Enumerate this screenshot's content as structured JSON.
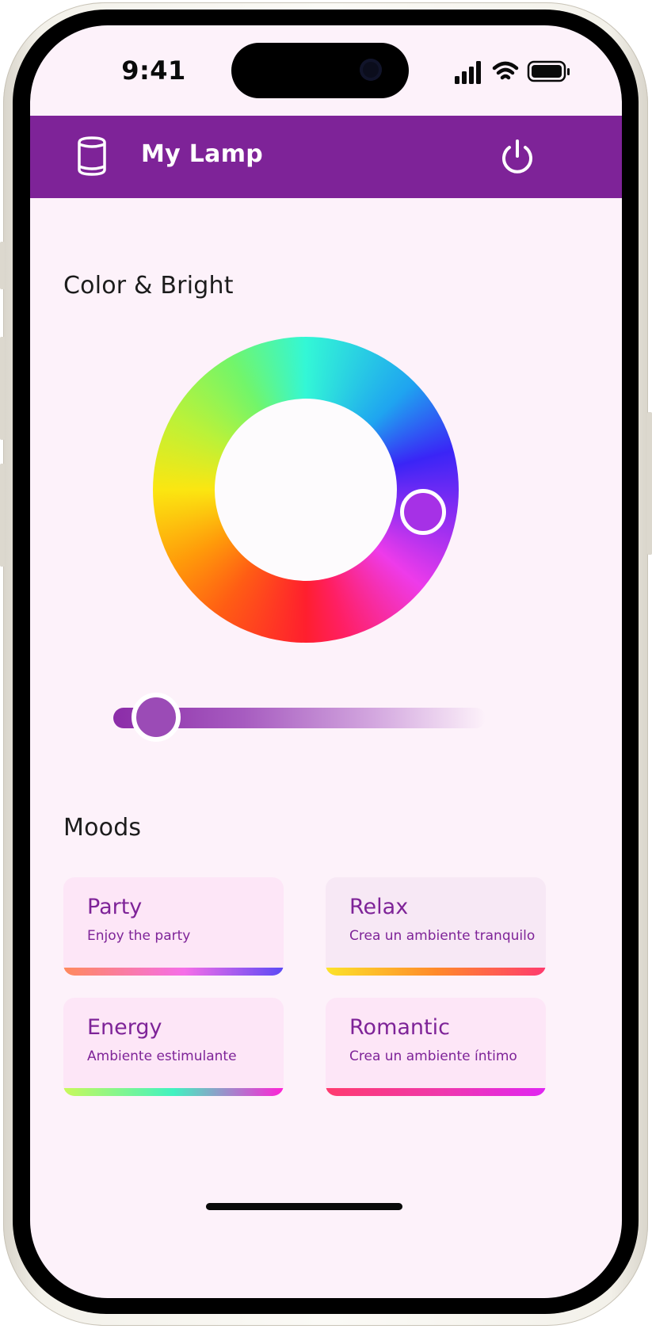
{
  "status_bar": {
    "time": "9:41"
  },
  "header": {
    "title": "My Lamp",
    "background": "#7e2398"
  },
  "color_section": {
    "title": "Color & Bright",
    "selected_color": "#a631e6",
    "brightness_percent": 12
  },
  "moods": {
    "title": "Moods",
    "items": [
      {
        "name": "Party",
        "subtitle": "Enjoy the party",
        "gradient": [
          "#ff8a5c",
          "#f56ee8",
          "#5b4af5"
        ]
      },
      {
        "name": "Relax",
        "subtitle": "Crea un ambiente tranquilo",
        "gradient": [
          "#fce32a",
          "#ff8a2a",
          "#ff3b6e"
        ]
      },
      {
        "name": "Energy",
        "subtitle": "Ambiente estimulante",
        "gradient": [
          "#c9f95a",
          "#41f2c0",
          "#ff22d6"
        ]
      },
      {
        "name": "Romantic",
        "subtitle": "Crea un ambiente íntimo",
        "gradient": [
          "#ff3b6e",
          "#f03aa8",
          "#e026f2"
        ]
      }
    ]
  }
}
